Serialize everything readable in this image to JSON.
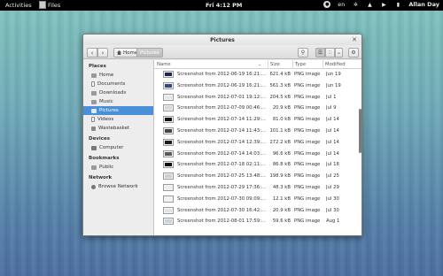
{
  "topbar": {
    "activities": "Activities",
    "app_name": "Files",
    "clock": "Fri  4:12 PM",
    "keyboard_layout": "en",
    "user": "Allan Day"
  },
  "window": {
    "title": "Pictures",
    "breadcrumbs": [
      "Home",
      "Pictures"
    ]
  },
  "sidebar": {
    "places_heading": "Places",
    "places": [
      {
        "label": "Home",
        "icon": "home-icon"
      },
      {
        "label": "Documents",
        "icon": "documents-icon"
      },
      {
        "label": "Downloads",
        "icon": "downloads-icon"
      },
      {
        "label": "Music",
        "icon": "music-icon"
      },
      {
        "label": "Pictures",
        "icon": "pictures-icon",
        "selected": true
      },
      {
        "label": "Videos",
        "icon": "videos-icon"
      },
      {
        "label": "Wastebasket",
        "icon": "trash-icon"
      }
    ],
    "devices_heading": "Devices",
    "devices": [
      {
        "label": "Computer",
        "icon": "computer-icon"
      }
    ],
    "bookmarks_heading": "Bookmarks",
    "bookmarks": [
      {
        "label": "Public",
        "icon": "folder-icon"
      }
    ],
    "network_heading": "Network",
    "network": [
      {
        "label": "Browse Network",
        "icon": "network-icon"
      }
    ]
  },
  "filelist": {
    "columns": {
      "name": "Name",
      "size": "Size",
      "type": "Type",
      "modified": "Modified"
    },
    "files": [
      {
        "name": "Screenshot from 2012-06-19 16:21:...",
        "size": "621.4 kB",
        "type": "PNG image",
        "modified": "Jun 19",
        "thumb": "#1a2a4a"
      },
      {
        "name": "Screenshot from 2012-06-19 16:21:...",
        "size": "561.3 kB",
        "type": "PNG image",
        "modified": "Jun 19",
        "thumb": "#2b4c7e"
      },
      {
        "name": "Screenshot from 2012-07-01 19:12:...",
        "size": "204.5 kB",
        "type": "PNG image",
        "modified": "Jul 1",
        "thumb": "#e8e8e8"
      },
      {
        "name": "Screenshot from 2012-07-09 00:46:...",
        "size": "20.9 kB",
        "type": "PNG image",
        "modified": "Jul 9",
        "thumb": "#d8d8d8"
      },
      {
        "name": "Screenshot from 2012-07-14 11:29:...",
        "size": "81.0 kB",
        "type": "PNG image",
        "modified": "Jul 14",
        "thumb": "#111111"
      },
      {
        "name": "Screenshot from 2012-07-14 11:43:...",
        "size": "101.1 kB",
        "type": "PNG image",
        "modified": "Jul 14",
        "thumb": "#444444"
      },
      {
        "name": "Screenshot from 2012-07-14 12:39:...",
        "size": "272.2 kB",
        "type": "PNG image",
        "modified": "Jul 14",
        "thumb": "#1b1b1b"
      },
      {
        "name": "Screenshot from 2012-07-14 14:03:...",
        "size": "96.6 kB",
        "type": "PNG image",
        "modified": "Jul 14",
        "thumb": "#5a5a5a"
      },
      {
        "name": "Screenshot from 2012-07-18 02:11:...",
        "size": "86.8 kB",
        "type": "PNG image",
        "modified": "Jul 18",
        "thumb": "#0d0d0d"
      },
      {
        "name": "Screenshot from 2012-07-25 13:48:...",
        "size": "198.9 kB",
        "type": "PNG image",
        "modified": "Jul 25",
        "thumb": "#cfcfcf"
      },
      {
        "name": "Screenshot from 2012-07-29 17:36:...",
        "size": "48.3 kB",
        "type": "PNG image",
        "modified": "Jul 29",
        "thumb": "#eeeeee"
      },
      {
        "name": "Screenshot from 2012-07-30 09:09:...",
        "size": "12.1 kB",
        "type": "PNG image",
        "modified": "Jul 30",
        "thumb": "#f2f2f2"
      },
      {
        "name": "Screenshot from 2012-07-30 16:42:...",
        "size": "20.9 kB",
        "type": "PNG image",
        "modified": "Jul 30",
        "thumb": "#e4e4e4"
      },
      {
        "name": "Screenshot from 2012-08-01 17:59:...",
        "size": "59.6 kB",
        "type": "PNG image",
        "modified": "Aug 1",
        "thumb": "#c8d4e4"
      }
    ]
  }
}
